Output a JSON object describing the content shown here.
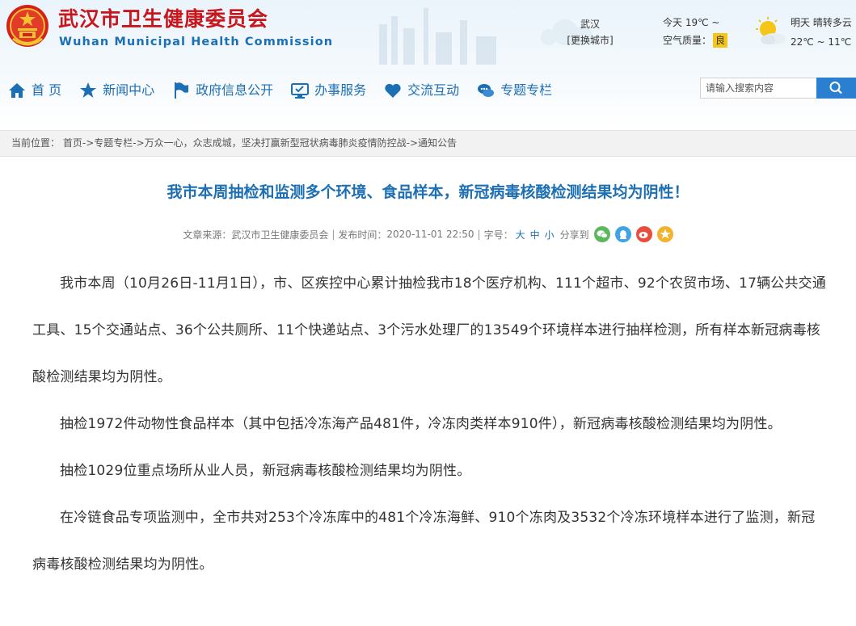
{
  "site": {
    "title": "武汉市卫生健康委员会",
    "subtitle": "Wuhan Municipal Health Commission"
  },
  "weather": {
    "city": "武汉",
    "change_city": "[更换城市]",
    "today": "今天 19℃ ~",
    "air_quality_label": "空气质量：",
    "air_quality_value": "良",
    "tomorrow": "明天  晴转多云",
    "tomorrow_temp": "22℃ ~ 11℃",
    "colors": {
      "aqi": "#f5c518"
    }
  },
  "nav": [
    {
      "label": "首  页",
      "icon": "home-icon"
    },
    {
      "label": "新闻中心",
      "icon": "star-icon"
    },
    {
      "label": "政府信息公开",
      "icon": "flag-icon"
    },
    {
      "label": "办事服务",
      "icon": "monitor-icon"
    },
    {
      "label": "交流互动",
      "icon": "heart-icon"
    },
    {
      "label": "专题专栏",
      "icon": "chat-icon"
    }
  ],
  "search": {
    "placeholder": "请输入搜索内容"
  },
  "breadcrumb": {
    "label": "当前位置：",
    "items": [
      "首页",
      "专题专栏",
      "万众一心，众志成城，坚决打赢新型冠状病毒肺炎疫情防控战",
      "通知公告"
    ],
    "separator": "->"
  },
  "article": {
    "title": "我市本周抽检和监测多个环境、食品样本，新冠病毒核酸检测结果均为阴性！",
    "source_label": "文章来源：",
    "source": "武汉市卫生健康委员会",
    "publish_label": "发布时间：",
    "publish_time": "2020-11-01 22:50",
    "fontsize_label": "字号：",
    "font_sizes": [
      "大",
      "中",
      "小"
    ],
    "share_label": "分享到",
    "share_icons": [
      "wechat-icon",
      "qzone-icon",
      "weibo-icon",
      "favorite-icon"
    ],
    "paragraphs": [
      "我市本周（10月26日-11月1日），市、区疾控中心累计抽检我市18个医疗机构、111个超市、92个农贸市场、17辆公共交通工具、15个交通站点、36个公共厕所、11个快递站点、3个污水处理厂的13549个环境样本进行抽样检测，所有样本新冠病毒核酸检测结果均为阴性。",
      "抽检1972件动物性食品样本（其中包括冷冻海产品481件，冷冻肉类样本910件），新冠病毒核酸检测结果均为阴性。",
      "抽检1029位重点场所从业人员，新冠病毒核酸检测结果均为阴性。",
      "在冷链食品专项监测中，全市共对253个冷冻库中的481个冷冻海鲜、910个冻肉及3532个冷冻环境样本进行了监测，新冠病毒核酸检测结果均为阴性。"
    ]
  },
  "colors": {
    "brand_red": "#c8161d",
    "brand_blue": "#1d6fb4",
    "search_button": "#2b7fd0"
  }
}
